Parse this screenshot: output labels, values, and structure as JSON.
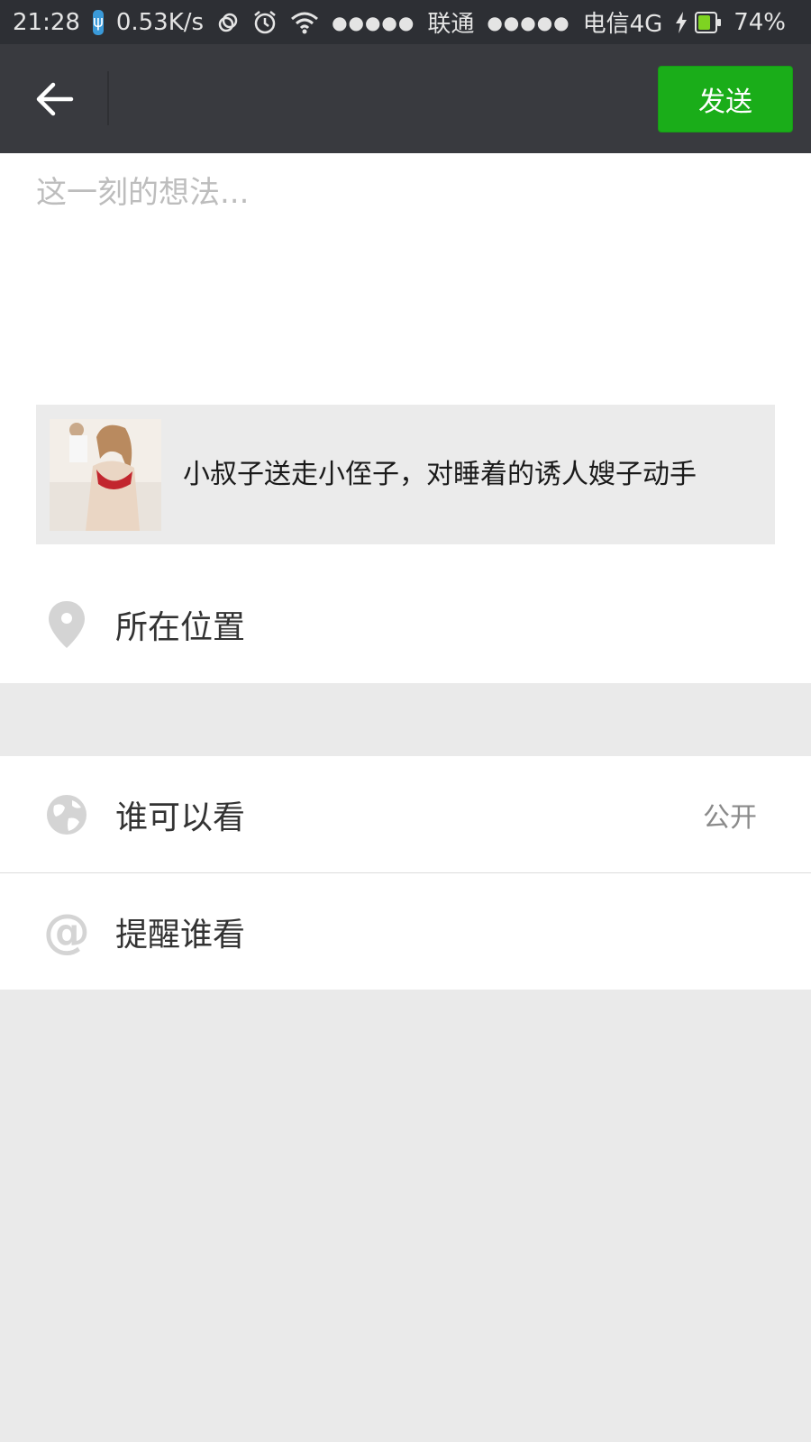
{
  "status_bar": {
    "time": "21:28",
    "usb_icon": "usb-icon",
    "net_speed": "0.53K/s",
    "carrier1_signal": "●●●●●",
    "carrier1": "联通",
    "carrier2_signal": "●●●●●",
    "carrier2": "电信4G",
    "battery_percent": "74%",
    "battery_level": 0.74
  },
  "header": {
    "back_icon": "arrow-left-icon",
    "send_label": "发送",
    "send_color": "#1aad19"
  },
  "compose": {
    "placeholder": "这一刻的想法..."
  },
  "link_card": {
    "title": "小叔子送走小侄子，对睡着的诱人嫂子动手"
  },
  "location": {
    "icon": "location-pin-icon",
    "label": "所在位置"
  },
  "visibility": {
    "icon": "globe-icon",
    "label": "谁可以看",
    "value": "公开"
  },
  "mention": {
    "icon": "at-icon",
    "label": "提醒谁看"
  }
}
